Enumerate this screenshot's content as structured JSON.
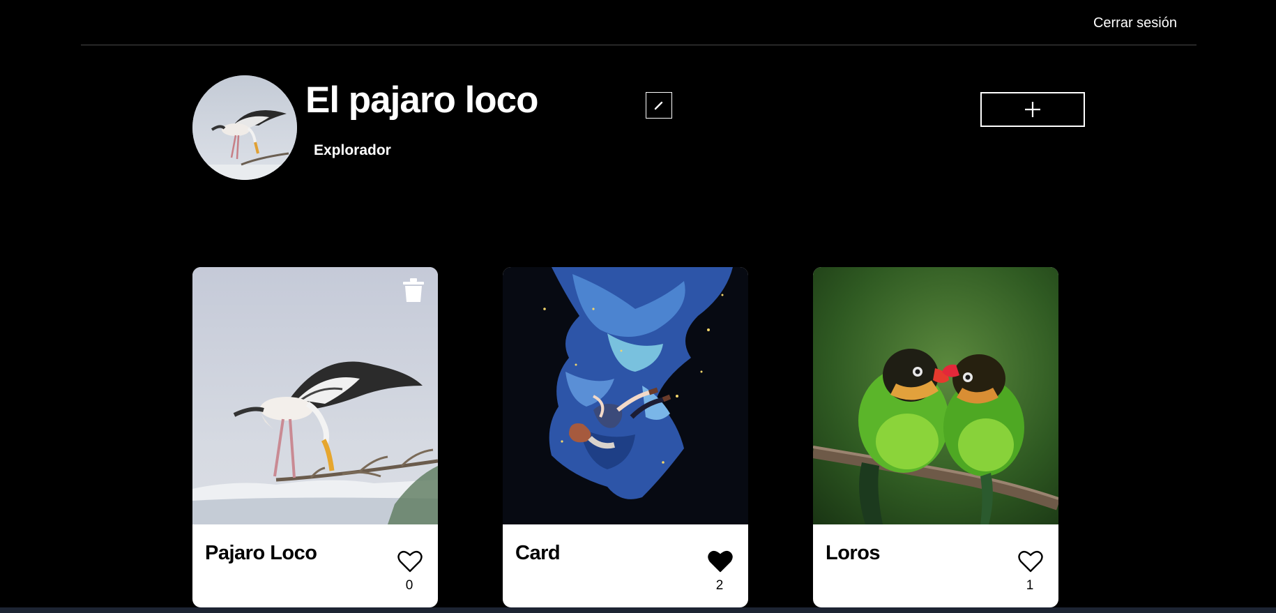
{
  "header": {
    "logout_label": "Cerrar sesión"
  },
  "profile": {
    "name": "El pajaro loco",
    "about": "Explorador",
    "avatar_icon": "stork-photo",
    "edit_icon": "pencil-icon",
    "add_icon": "plus-icon"
  },
  "cards": [
    {
      "title": "Pajaro Loco",
      "likes": "0",
      "liked": false,
      "deletable": true,
      "image": "stork-photo"
    },
    {
      "title": "Card",
      "likes": "2",
      "liked": true,
      "deletable": false,
      "image": "anime-girl-falling-illustration"
    },
    {
      "title": "Loros",
      "likes": "1",
      "liked": false,
      "deletable": false,
      "image": "lovebirds-photo"
    }
  ],
  "colors": {
    "background": "#000000",
    "card_background": "#ffffff",
    "text": "#ffffff",
    "divider": "#4a4a4a"
  }
}
